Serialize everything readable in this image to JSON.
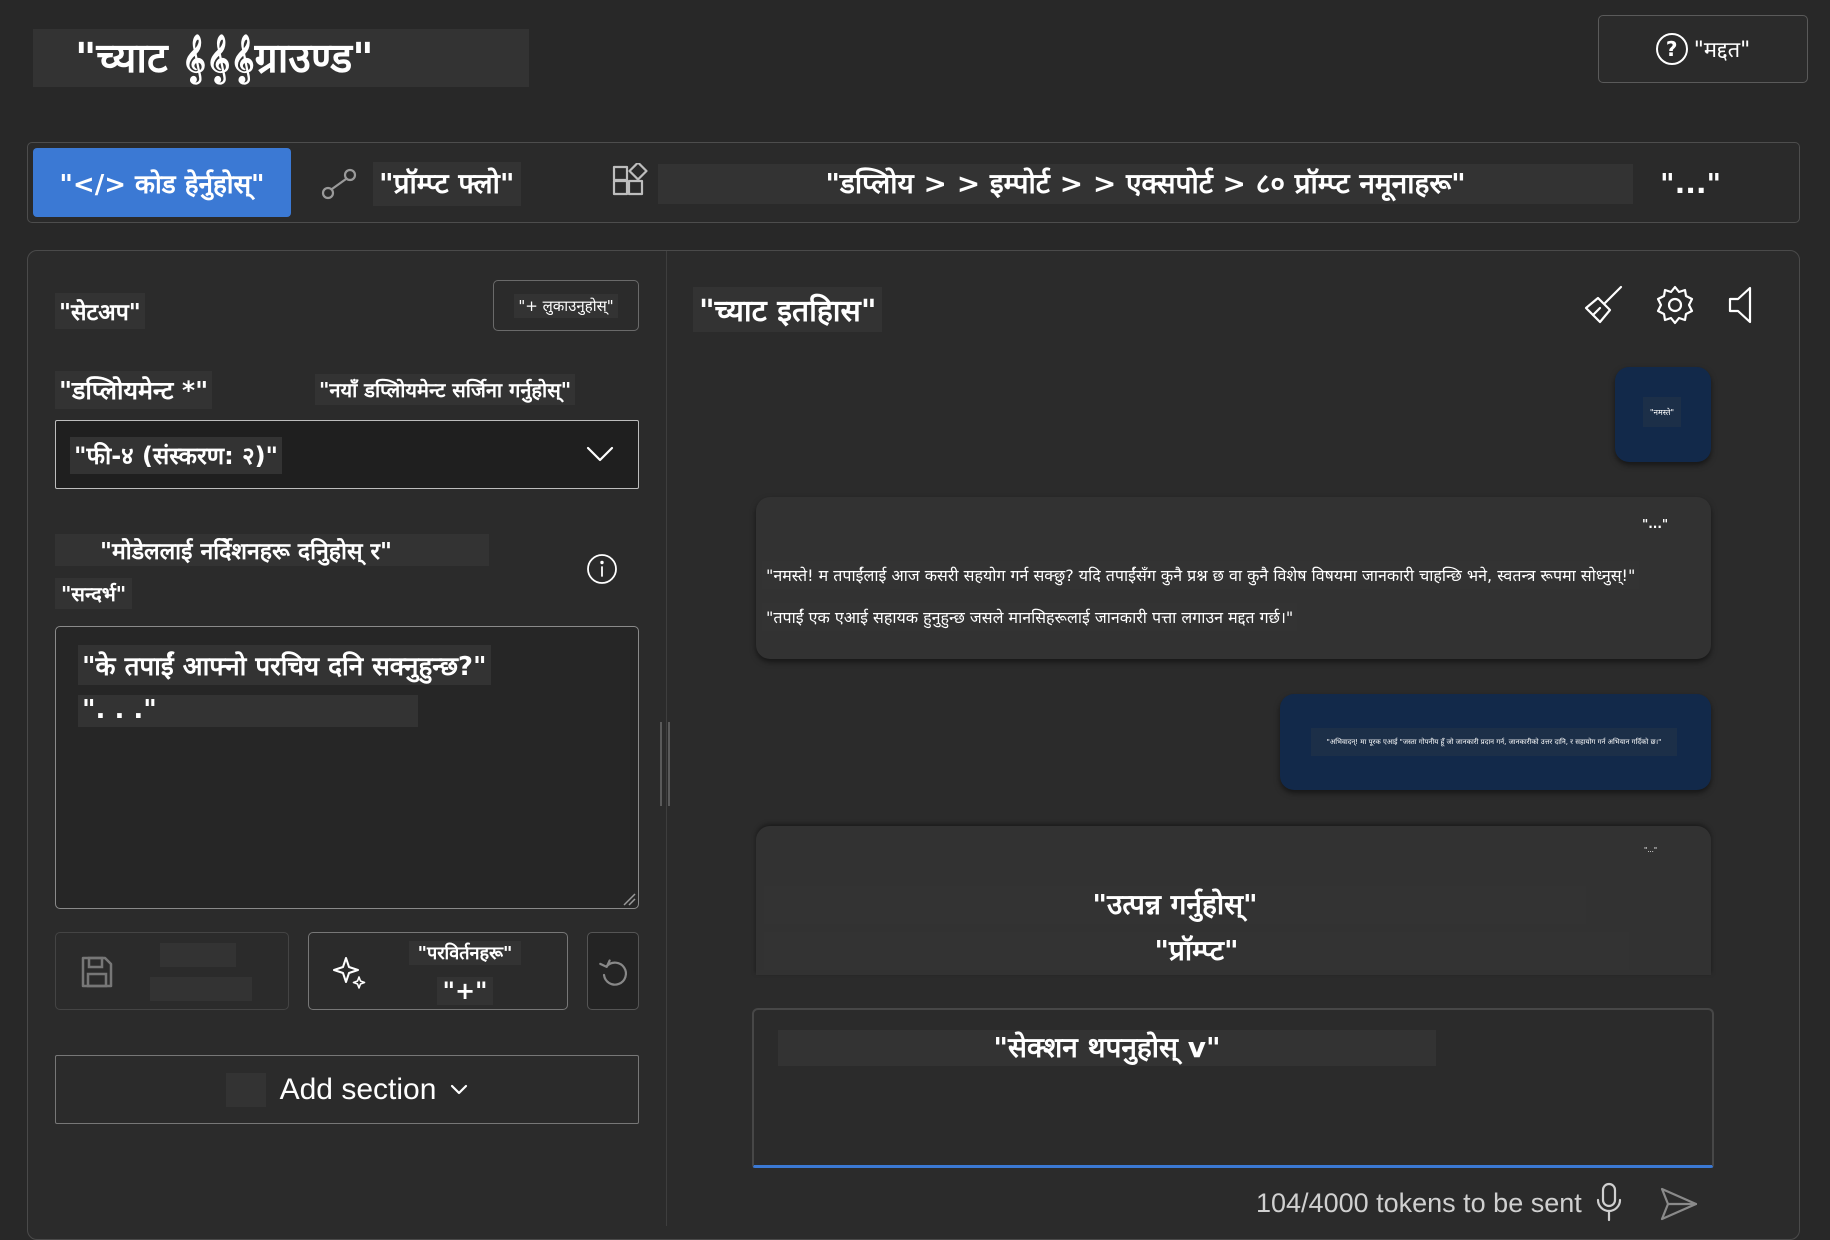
{
  "app": {
    "title": "\"च्याट 𝄞𝄞𝄞ग्राउण्ड\"",
    "help_label": "\"मद्दत\""
  },
  "toolbar": {
    "view_code": "\"</> कोड हेर्नुहोस्\"",
    "prompt_flow": "\"प्रॉम्प्ट फ्लो\"",
    "menu_path": "\"डप्लिोय > > इम्पोर्ट > > एक्सपोर्ट > ८० प्रॉम्प्ट नमूनाहरू\"",
    "more": "\"...\""
  },
  "setup": {
    "title": "\"सेटअप\"",
    "hide_button": "\"+ लुकाउनुहोस्\"",
    "deployment_label": "\"डप्लिोयमेन्ट *\"",
    "create_deployment_link": "\"नयाँ डप्लिोयमेन्ट सर्जिना गर्नुहोस्\"",
    "deployment_value": "\"फी-४ (संस्करण: २)\"",
    "instructions_label": "\"मोडेललाई नर्दिेशनहरू दनिुहोस् र\"",
    "context_label": "\"सन्दर्भ\"",
    "system_message_line1": "\"के तपाईं आफ्नो परचिय दनि सक्नुहुन्छ?\"",
    "system_message_line2": "\". . .\"",
    "changes_label": "\"परविर्तनहरू\"",
    "changes_plus": "\"+\"",
    "add_section": "Add section"
  },
  "chat": {
    "title": "\"च्याट इतहिास\"",
    "messages": [
      {
        "role": "user",
        "text": "\"नमस्ते\""
      },
      {
        "role": "assistant",
        "more": "\"...\"",
        "lines": [
          "\"नमस्ते! म तपाईंलाई आज कसरी सहयोग गर्न सक्छु? यदि तपाईंसँग कुनै प्रश्न छ वा कुनै विशेष विषयमा जानकारी चाहन्छि भने, स्वतन्त्र रूपमा सोध्नुस्!\"",
          "\"तपाईं एक एआई सहायक हुनुहुन्छ जसले मानसिहरूलाई जानकारी पत्ता लगाउन मद्दत गर्छ।\""
        ]
      },
      {
        "role": "user",
        "text": "\"अभिवादन्! मा पूरक एआई \"जस्ता गोपनीय हूँ जो जानकारी प्रदान गर्न, जानकारीको उत्तर दानि, र सहायोग गर्न अभियान गर्दिको छ।\""
      },
      {
        "role": "assistant",
        "more": "\"...\"",
        "lines": [
          "\"उत्पन्न गर्नुहोस्\"",
          "\"प्रॉम्प्ट\""
        ]
      }
    ],
    "input_text": "\"सेक्शन थपनुहोस् v\"",
    "token_counter": "104/4000 tokens to be sent"
  },
  "colors": {
    "background": "#282828",
    "accent": "#3b79d4",
    "user_bubble": "#12294a",
    "assistant_bubble": "#323232"
  },
  "icons": [
    "help-icon",
    "prompt-flow-icon",
    "grid-icon",
    "chevron-down-icon",
    "info-icon",
    "save-icon",
    "sparkle-icon",
    "undo-icon",
    "broom-icon",
    "gear-icon",
    "speaker-icon",
    "mic-icon",
    "send-icon"
  ]
}
